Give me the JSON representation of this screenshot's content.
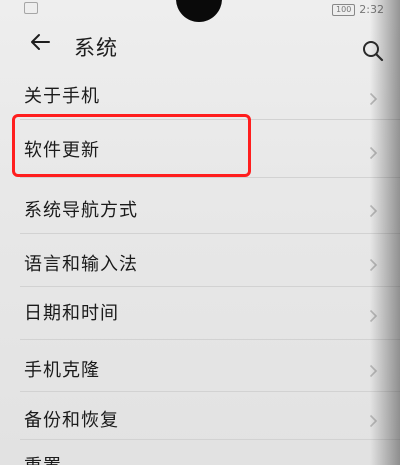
{
  "status_bar": {
    "battery": "100",
    "time": "2:32"
  },
  "header": {
    "title": "系统",
    "back_icon": "arrow-left-icon",
    "search_icon": "search-icon"
  },
  "menu": {
    "items": [
      {
        "label": "关于手机"
      },
      {
        "label": "软件更新",
        "highlighted": true
      },
      {
        "label": "系统导航方式"
      },
      {
        "label": "语言和输入法"
      },
      {
        "label": "日期和时间"
      },
      {
        "label": "手机克隆"
      },
      {
        "label": "备份和恢复"
      },
      {
        "label": "重置"
      }
    ]
  },
  "colors": {
    "highlight": "#ff1e1e",
    "text": "#1b1b1b",
    "background": "#eeeeee"
  }
}
